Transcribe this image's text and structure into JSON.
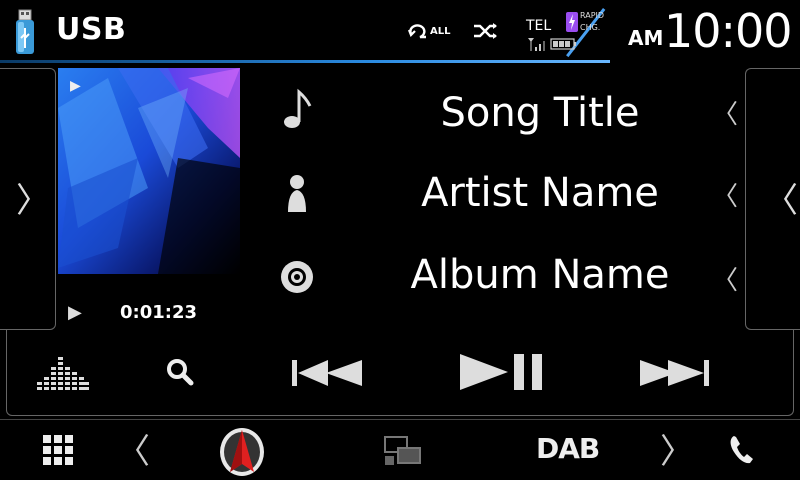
{
  "header": {
    "source_title": "USB",
    "repeat_label": "ALL",
    "tel_label": "TEL",
    "rapid_charge_label_1": "RAPID",
    "rapid_charge_label_2": "CHG.",
    "ampm": "AM",
    "clock": "10:00",
    "icons": [
      "usb-stick-icon",
      "repeat-icon",
      "shuffle-icon",
      "signal-icon",
      "battery-icon",
      "rapid-charge-icon"
    ]
  },
  "now_playing": {
    "song_title": "Song Title",
    "artist_name": "Artist Name",
    "album_name": "Album Name",
    "play_time": "0:01:23"
  },
  "transport": {
    "buttons": [
      "equalizer-icon",
      "search-icon",
      "previous-track-icon",
      "play-pause-icon",
      "next-track-icon"
    ]
  },
  "bottom_bar": {
    "dab_label": "DAB",
    "icons": [
      "grid-menu-icon",
      "chevron-left-icon",
      "navigation-logo-icon",
      "screen-mirror-icon",
      "dab-icon",
      "chevron-right-icon",
      "phone-icon"
    ]
  },
  "colors": {
    "accent_blue": "#2a8ae0",
    "rapid_charge_purple": "#9a4df0",
    "nav_red": "#e02020"
  }
}
